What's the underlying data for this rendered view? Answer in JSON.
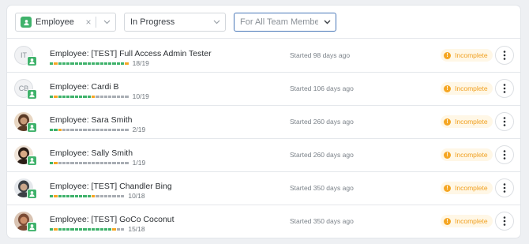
{
  "filters": {
    "role": {
      "label": "Employee",
      "clear_icon": "×"
    },
    "status": {
      "label": "In Progress"
    },
    "team": {
      "placeholder": "For All Team Members"
    }
  },
  "colors": {
    "done": "#3fb26b",
    "current": "#f5a623",
    "todo": "#a9aeb4",
    "incomplete": "#f0a020"
  },
  "rows": [
    {
      "avatar_initials": "IT",
      "avatar_type": "initials",
      "name": "Employee: [TEST] Full Access Admin Tester",
      "progress_done": 18,
      "progress_total": 19,
      "count": "18/19",
      "started": "Started 98 days ago",
      "status": "Incomplete"
    },
    {
      "avatar_initials": "CB",
      "avatar_type": "initials",
      "name": "Employee: Cardi B",
      "progress_done": 10,
      "progress_total": 19,
      "count": "10/19",
      "started": "Started 106 days ago",
      "status": "Incomplete"
    },
    {
      "avatar_type": "photo",
      "name": "Employee: Sara Smith",
      "progress_done": 2,
      "progress_total": 19,
      "count": "2/19",
      "started": "Started 260 days ago",
      "status": "Incomplete"
    },
    {
      "avatar_type": "photo",
      "name": "Employee: Sally Smith",
      "progress_done": 1,
      "progress_total": 19,
      "count": "1/19",
      "started": "Started 260 days ago",
      "status": "Incomplete"
    },
    {
      "avatar_type": "photo",
      "name": "Employee: [TEST] Chandler Bing",
      "progress_done": 10,
      "progress_total": 18,
      "count": "10/18",
      "started": "Started 350 days ago",
      "status": "Incomplete"
    },
    {
      "avatar_type": "photo",
      "name": "Employee: [TEST] GoCo Coconut",
      "progress_done": 15,
      "progress_total": 18,
      "count": "15/18",
      "started": "Started 350 days ago",
      "status": "Incomplete"
    }
  ],
  "icons": {
    "badge": "user-icon",
    "status": "exclamation-icon",
    "more": "vertical-dots-icon"
  }
}
